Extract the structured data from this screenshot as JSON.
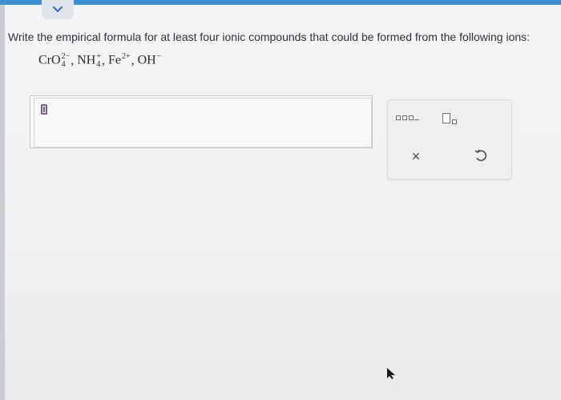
{
  "question": {
    "prompt": "Write the empirical formula for at least four ionic compounds that could be formed from the following ions:",
    "ions": [
      {
        "base": "CrO",
        "sub": "4",
        "sup": "2−"
      },
      {
        "base": "NH",
        "sub": "4",
        "sup": "+"
      },
      {
        "base": "Fe",
        "sub": "",
        "sup": "2+"
      },
      {
        "base": "OH",
        "sub": "",
        "sup": "−"
      }
    ],
    "separator": ","
  },
  "answer": {
    "value": ""
  },
  "palette": {
    "clear_symbol": "×",
    "subscript_label": "subscript",
    "superscript_label": "superscript",
    "undo_label": "undo"
  },
  "colors": {
    "accent": "#3d8fd6",
    "cursor": "#7a5f8a"
  }
}
